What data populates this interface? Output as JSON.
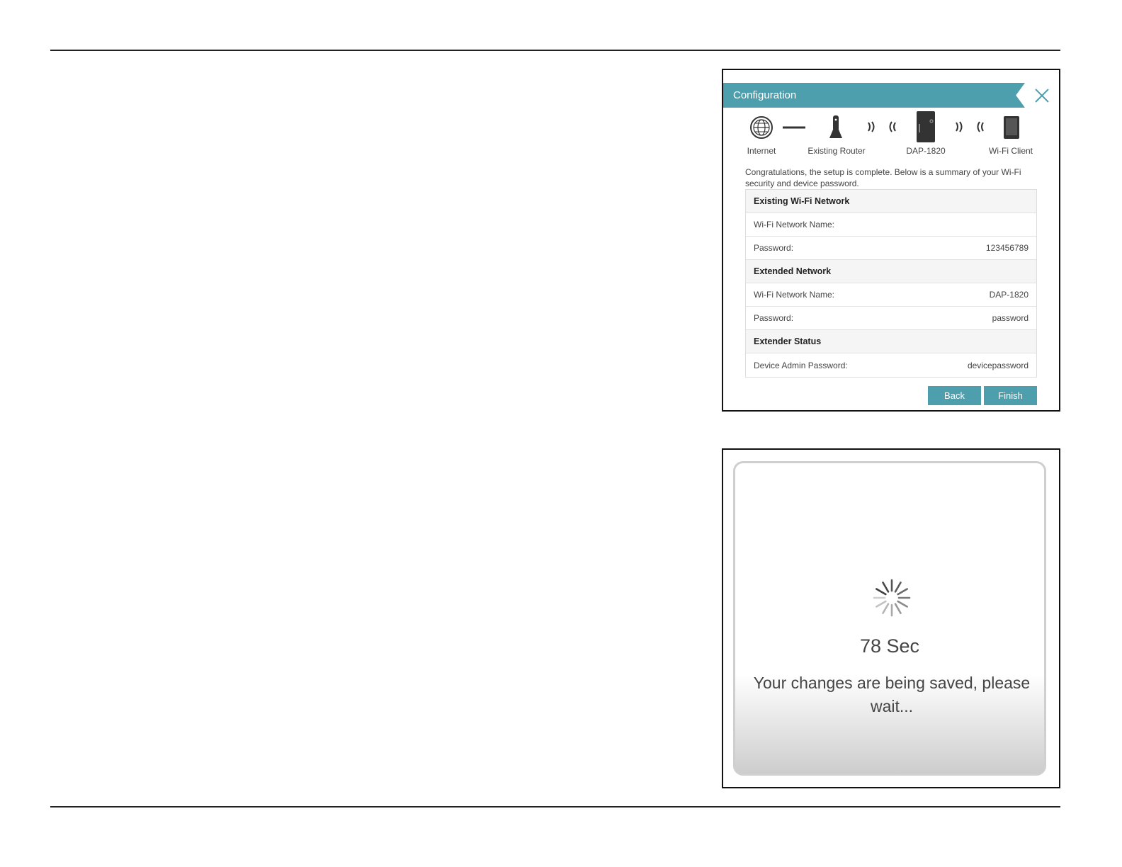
{
  "config": {
    "title": "Configuration",
    "topology": [
      {
        "label": "Internet",
        "icon": "globe-icon"
      },
      {
        "label": "Existing Router",
        "icon": "router-icon"
      },
      {
        "label": "DAP-1820",
        "icon": "extender-icon"
      },
      {
        "label": "Wi-Fi Client",
        "icon": "tablet-icon"
      }
    ],
    "intro_text": "Congratulations, the setup is complete. Below is a summary of your Wi-Fi security and device password.",
    "sections": [
      {
        "heading": "Existing Wi-Fi Network",
        "rows": [
          {
            "label": "Wi-Fi Network Name:",
            "value": ""
          },
          {
            "label": "Password:",
            "value": "123456789"
          }
        ]
      },
      {
        "heading": "Extended Network",
        "rows": [
          {
            "label": "Wi-Fi Network Name:",
            "value": "DAP-1820"
          },
          {
            "label": "Password:",
            "value": "password"
          }
        ]
      },
      {
        "heading": "Extender Status",
        "rows": [
          {
            "label": "Device Admin Password:",
            "value": "devicepassword"
          }
        ]
      }
    ],
    "back_label": "Back",
    "finish_label": "Finish",
    "accent_color": "#4d9fae"
  },
  "saving": {
    "countdown": "78 Sec",
    "message": "Your changes are being saved, please wait..."
  }
}
